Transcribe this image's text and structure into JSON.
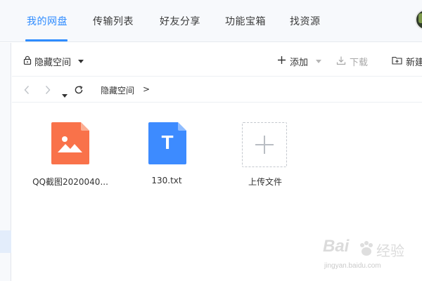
{
  "nav": {
    "tabs": [
      {
        "label": "我的网盘",
        "active": true
      },
      {
        "label": "传输列表",
        "active": false
      },
      {
        "label": "好友分享",
        "active": false
      },
      {
        "label": "功能宝箱",
        "active": false
      },
      {
        "label": "找资源",
        "active": false
      }
    ],
    "accent_color": "#2f8cff"
  },
  "toolbar": {
    "space_label": "隐藏空间",
    "add_label": "添加",
    "download_label": "下载",
    "new_label": "新建"
  },
  "breadcrumb": {
    "current": "隐藏空间",
    "separator": ">"
  },
  "files": [
    {
      "name": "QQ截图2020040...",
      "type": "image",
      "color": "#f9724a"
    },
    {
      "name": "130.txt",
      "type": "text",
      "color": "#3d8bff",
      "glyph": "T"
    }
  ],
  "upload": {
    "label": "上传文件"
  },
  "watermark": {
    "brand": "Bai",
    "brand_suffix": "经验",
    "url": "jingyan.baidu.com"
  }
}
